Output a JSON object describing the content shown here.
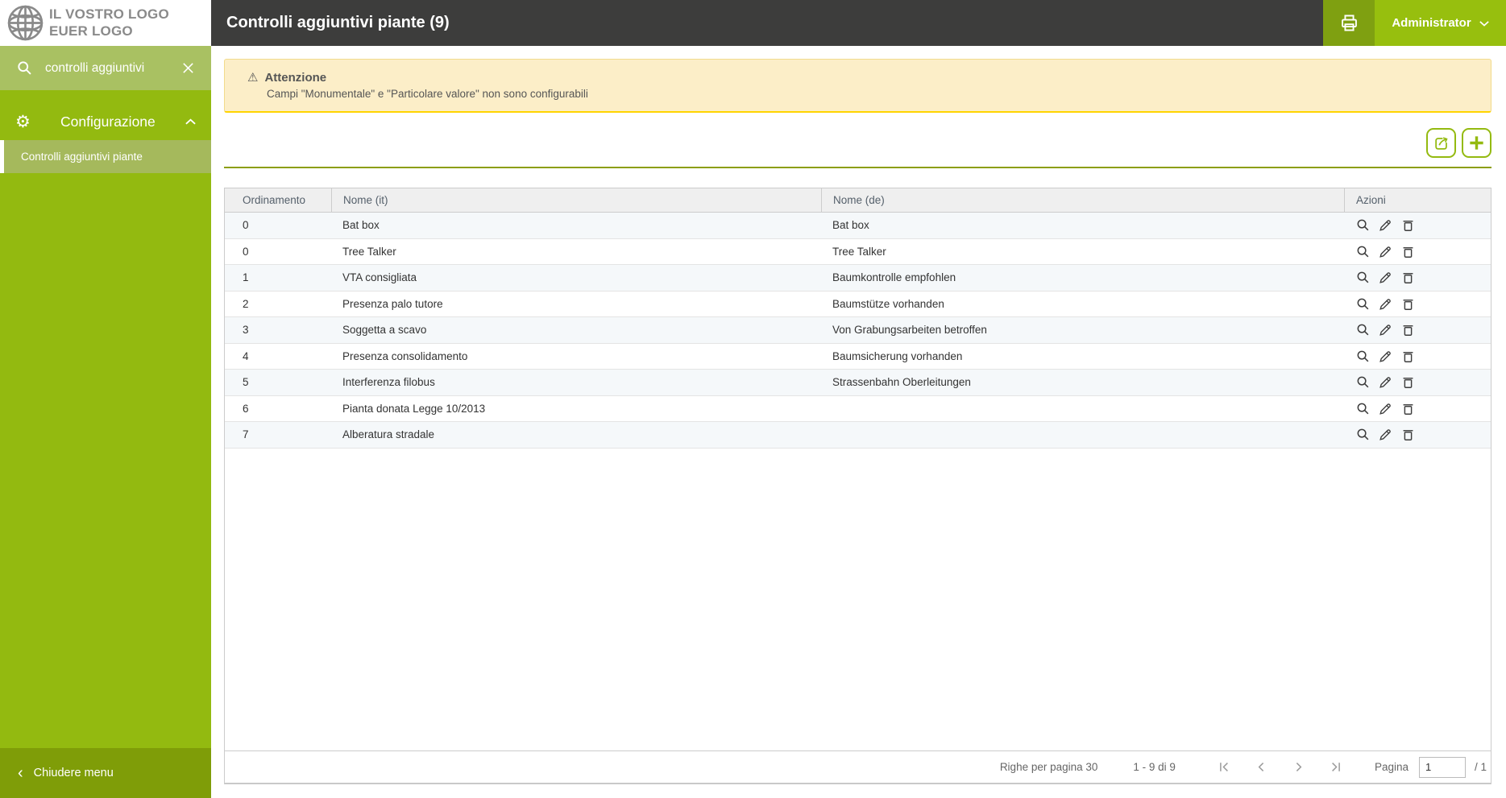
{
  "colors": {
    "accent_green": "#94BA10",
    "sidebar_green": "#93BA10",
    "sidebar_search_green": "#A9C162",
    "sidebar_selected_green": "#A5B95C",
    "sidebar_footer_green": "#7F9D08",
    "print_button_green": "#7FA011",
    "admin_button_green": "#97BF0E",
    "topbar_dark": "#3D3D3C",
    "warning_bg": "#FCEEC8",
    "warning_border_bottom": "#FFD400"
  },
  "icons": {
    "warning_glyph": "⚠",
    "gear_glyph": "⚙",
    "collapse_glyph": "‹"
  },
  "sidebar": {
    "logo": {
      "line1": "IL VOSTRO LOGO",
      "line2": "EUER LOGO"
    },
    "search": {
      "value": "controlli aggiuntivi"
    },
    "menu": {
      "header_label": "Configurazione",
      "item_label": "Controlli aggiuntivi piante"
    },
    "close_label": "Chiudere menu"
  },
  "header": {
    "title": "Controlli aggiuntivi piante (9)",
    "user": "Administrator"
  },
  "warning": {
    "title": "Attenzione",
    "message": "Campi \"Monumentale\" e \"Particolare valore\" non sono configurabili"
  },
  "table": {
    "columns": [
      "Ordinamento",
      "Nome (it)",
      "Nome (de)",
      "Azioni"
    ],
    "rows": [
      {
        "ordinamento": "0",
        "nome_it": "Bat box",
        "nome_de": "Bat box"
      },
      {
        "ordinamento": "0",
        "nome_it": "Tree Talker",
        "nome_de": "Tree Talker"
      },
      {
        "ordinamento": "1",
        "nome_it": "VTA consigliata",
        "nome_de": "Baumkontrolle empfohlen"
      },
      {
        "ordinamento": "2",
        "nome_it": "Presenza palo tutore",
        "nome_de": "Baumstütze vorhanden"
      },
      {
        "ordinamento": "3",
        "nome_it": "Soggetta a scavo",
        "nome_de": "Von Grabungsarbeiten betroffen"
      },
      {
        "ordinamento": "4",
        "nome_it": "Presenza consolidamento",
        "nome_de": "Baumsicherung vorhanden"
      },
      {
        "ordinamento": "5",
        "nome_it": "Interferenza filobus",
        "nome_de": "Strassenbahn Oberleitungen"
      },
      {
        "ordinamento": "6",
        "nome_it": "Pianta donata Legge 10/2013",
        "nome_de": ""
      },
      {
        "ordinamento": "7",
        "nome_it": "Alberatura stradale",
        "nome_de": ""
      }
    ]
  },
  "pagination": {
    "rows_per_page": "Righe per pagina 30",
    "range": "1 - 9 di 9",
    "page_label": "Pagina",
    "page_value": "1",
    "page_total": "/ 1"
  }
}
